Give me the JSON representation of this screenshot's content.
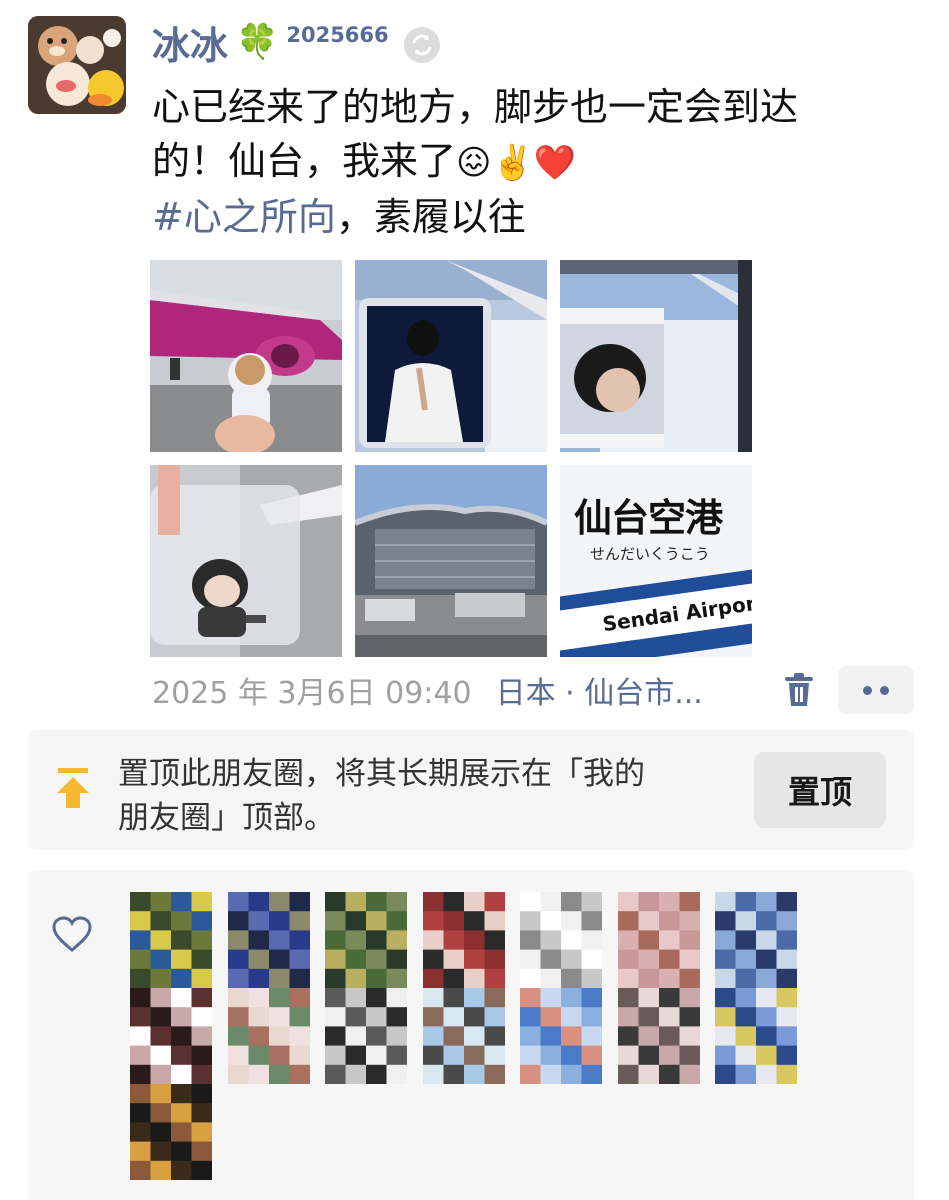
{
  "user": {
    "name": "冰冰",
    "clover": "🍀",
    "badge_id": "2025666"
  },
  "post": {
    "line1": "心已经来了的地方，脚步也一定会到达",
    "line2": "的！仙台，我来了",
    "line2_emojis": "😖✌️❤️",
    "hashtag": "#心之所向",
    "line3_rest": "，素履以往",
    "photos": [
      {
        "name": "photo-plane-plush"
      },
      {
        "name": "photo-window-poster"
      },
      {
        "name": "photo-window-portrait"
      },
      {
        "name": "photo-plush-window"
      },
      {
        "name": "photo-airport-terminal"
      },
      {
        "name": "photo-sendai-sign",
        "sign_main": "仙台空港",
        "sign_kana": "せんだいくうこう",
        "sign_en": "Sendai Airport"
      }
    ]
  },
  "meta": {
    "time": "2025 年 3月6日 09:40",
    "location": "日本 · 仙台市..."
  },
  "pin": {
    "text_line1": "置顶此朋友圈，将其长期展示在「我的",
    "text_line2": "朋友圈」顶部。",
    "button_label": "置顶"
  },
  "icons": {
    "sync": "sync-icon",
    "trash": "trash-icon",
    "more": "more-icon",
    "pin": "pin-top-icon",
    "like": "heart-outline-icon"
  },
  "colors": {
    "link": "#576b95",
    "muted": "#a0a0a0",
    "pin": "#f5b82e",
    "panel": "#f6f6f6"
  },
  "likes": {
    "liker_count": 15,
    "avatar_palettes": [
      [
        "#3a4a2a",
        "#d8c94a",
        "#2a5a9a",
        "#6b7a3a"
      ],
      [
        "#2a3a8a",
        "#5a6ab0",
        "#1f2a4a",
        "#8a8a6a"
      ],
      [
        "#4a6a3a",
        "#b8b060",
        "#2a3a2a",
        "#7a8a5a"
      ],
      [
        "#b04040",
        "#e8d0c8",
        "#2a2a2a",
        "#8a3030"
      ],
      [
        "#ffffff",
        "#c8c8c8",
        "#8a8a8a",
        "#f0f0f0"
      ],
      [
        "#c89898",
        "#e8c8c8",
        "#a86a5a",
        "#d8b0b0"
      ],
      [
        "#8aa8d8",
        "#4a6aa8",
        "#c8d8e8",
        "#2a3a6a"
      ],
      [
        "#5a3030",
        "#ffffff",
        "#c8a8a8",
        "#2a1a1a"
      ],
      [
        "#e8d8d0",
        "#a87060",
        "#6a8a6a",
        "#f0e0e0"
      ],
      [
        "#c8c8c8",
        "#5a5a5a",
        "#f0f0f0",
        "#2a2a2a"
      ],
      [
        "#a8c8e8",
        "#4a4a4a",
        "#d8e8f0",
        "#8a6a5a"
      ],
      [
        "#4a7ac8",
        "#8ab0e0",
        "#c8d8f0",
        "#d89080"
      ],
      [
        "#6a5a5a",
        "#c8a8a8",
        "#3a3a3a",
        "#e8d8d8"
      ],
      [
        "#7a9ad8",
        "#2a4a8a",
        "#d8c860",
        "#e8e8f0"
      ],
      [
        "#3a2a1a",
        "#d8a040",
        "#8a5a3a",
        "#1a1a1a"
      ]
    ]
  }
}
